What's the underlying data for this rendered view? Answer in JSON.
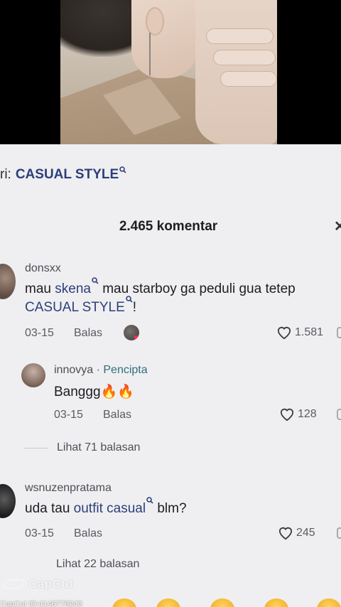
{
  "search_bar": {
    "prefix": "ri:",
    "query": "CASUAL STYLE",
    "search_sup": "ᵒ"
  },
  "header": {
    "comment_count": "2.465 komentar"
  },
  "comments": [
    {
      "username": "donsxx",
      "text_parts": [
        "mau ",
        "skena",
        " mau starboy ga peduli gua tetep"
      ],
      "text_line2": "CASUAL STYLE",
      "text_line2_tail": "!",
      "date": "03-15",
      "reply_label": "Balas",
      "likes": "1.581"
    },
    {
      "username": "innovya",
      "creator_tag": "· Pencipta",
      "text": "Banggg🔥🔥",
      "date": "03-15",
      "reply_label": "Balas",
      "likes": "128",
      "view_replies": "Lihat 71 balasan"
    },
    {
      "username": "wsnuzenpratama",
      "text_parts": [
        "uda tau ",
        "outfit casual",
        " blm?"
      ],
      "date": "03-15",
      "reply_label": "Balas",
      "likes": "245",
      "view_replies": "Lihat 22 balasan"
    }
  ],
  "watermark": {
    "brand": "CapCut",
    "id_text": "CapCut ID:4146779243"
  },
  "icons": {
    "like": "heart-outline-icon",
    "search_keyword": "search-magnifier-icon",
    "close": "close-icon"
  },
  "colors": {
    "keyword_link": "#2c3f7a",
    "creator_tag": "#2e6f7e",
    "sheet_bg": "#efeff1"
  }
}
